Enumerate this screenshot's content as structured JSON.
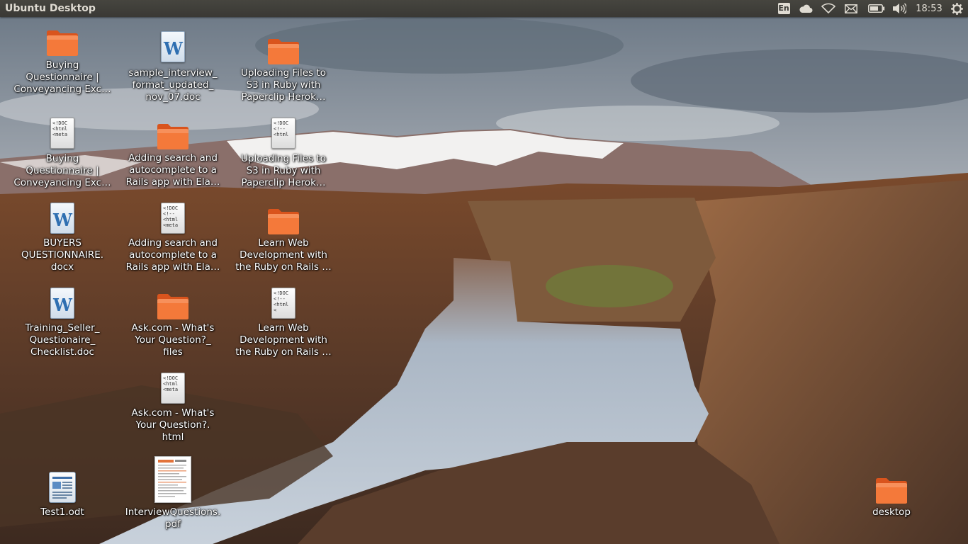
{
  "panel": {
    "title": "Ubuntu Desktop",
    "keyboard_layout": "En",
    "clock": "18:53",
    "indicators": [
      "keyboard-layout-icon",
      "cloud-icon",
      "wifi-icon",
      "mail-icon",
      "battery-icon",
      "volume-icon",
      "clock",
      "gear-icon"
    ]
  },
  "colors": {
    "panel_bg": "#3c3b37",
    "panel_text": "#dfdbd2",
    "folder_orange": "#f26d28",
    "label_text": "#ffffff"
  },
  "desktop": {
    "icons": [
      {
        "label": "Buying\nQuestionnaire |\nConveyancing Exc…",
        "type": "folder",
        "icon": "folder-icon"
      },
      {
        "label": "sample_interview_\nformat_updated_\nnov_07.doc",
        "type": "word",
        "icon": "word-document-icon"
      },
      {
        "label": "Uploading Files to\nS3 in Ruby with\nPaperclip   Herok…",
        "type": "folder",
        "icon": "folder-icon"
      },
      {
        "label": "Buying\nQuestionnaire |\nConveyancing Exc…",
        "type": "html",
        "icon": "html-file-icon",
        "preview": "<!DOC\n<html\n<meta"
      },
      {
        "label": "Adding search and\nautocomplete to a\nRails app with Ela…",
        "type": "folder",
        "icon": "folder-icon"
      },
      {
        "label": "Uploading Files to\nS3 in Ruby with\nPaperclip   Herok…",
        "type": "html",
        "icon": "html-file-icon",
        "preview": "<!DOC\n<!--\n<html"
      },
      {
        "label": "BUYERS\nQUESTIONNAIRE.\ndocx",
        "type": "word",
        "icon": "word-document-icon"
      },
      {
        "label": "Adding search and\nautocomplete to a\nRails app with Ela…",
        "type": "html",
        "icon": "html-file-icon",
        "preview": "<!DOC\n<!--\n<html\n<meta"
      },
      {
        "label": "Learn Web\nDevelopment with\nthe Ruby on Rails …",
        "type": "folder",
        "icon": "folder-icon"
      },
      {
        "label": "Training_Seller_\nQuestionaire_\nChecklist.doc",
        "type": "word",
        "icon": "word-document-icon"
      },
      {
        "label": "Ask.com - What's\nYour Question?_\nfiles",
        "type": "folder",
        "icon": "folder-icon"
      },
      {
        "label": "Learn Web\nDevelopment with\nthe Ruby on Rails …",
        "type": "html",
        "icon": "html-file-icon",
        "preview": "<!DOC\n<!--\n<html\n<"
      },
      {
        "label": "Ask.com - What's\nYour Question?.\nhtml",
        "type": "html",
        "icon": "html-file-icon",
        "preview": "<!DOC\n<html\n<meta"
      },
      {
        "label": "Test1.odt",
        "type": "odt",
        "icon": "odt-document-icon"
      },
      {
        "label": "InterviewQuestions.\npdf",
        "type": "pdf",
        "icon": "pdf-document-icon"
      },
      {
        "label": "desktop",
        "type": "folder",
        "icon": "folder-icon"
      }
    ]
  }
}
